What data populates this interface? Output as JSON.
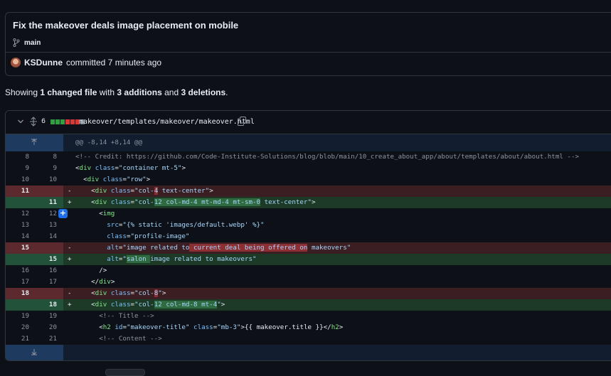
{
  "commit": {
    "title": "Fix the makeover deals image placement on mobile",
    "branch": "main",
    "author": "KSDunne",
    "committed_text": "committed 7 minutes ago"
  },
  "summary": {
    "prefix": "Showing ",
    "files": "1 changed file",
    "mid1": " with ",
    "additions": "3 additions",
    "mid2": " and ",
    "deletions": "3 deletions",
    "suffix": "."
  },
  "file": {
    "change_count": "6",
    "path": "makeover/templates/makeover/makeover.html",
    "diffstat": [
      "add",
      "add",
      "add",
      "del",
      "del",
      "del",
      "neutral"
    ],
    "colors": {
      "add": "#2ea043",
      "del": "#da3633",
      "neutral": "#6e7681"
    }
  },
  "diff": {
    "hunk_header": "@@ -8,14 +8,14 @@",
    "lines": [
      {
        "type": "ctx",
        "old": "8",
        "new": "8",
        "code": "<!-- Credit: https://github.com/Code-Institute-Solutions/blog/blob/main/10_create_about_app/about/templates/about/about.html -->"
      },
      {
        "type": "ctx",
        "old": "9",
        "new": "9",
        "code": "<div class=\"container mt-5\">"
      },
      {
        "type": "ctx",
        "old": "10",
        "new": "10",
        "code": "  <div class=\"row\">"
      },
      {
        "type": "del",
        "old": "11",
        "new": "",
        "code": "    <div class=\"col-4 text-center\">"
      },
      {
        "type": "add",
        "old": "",
        "new": "11",
        "code": "    <div class=\"col-12 col-md-4 mt-md-4 mt-sm-0 text-center\">"
      },
      {
        "type": "ctx",
        "old": "12",
        "new": "12",
        "code": "      <img"
      },
      {
        "type": "ctx",
        "old": "13",
        "new": "13",
        "code": "        src=\"{% static 'images/default.webp' %}\""
      },
      {
        "type": "ctx",
        "old": "14",
        "new": "14",
        "code": "        class=\"profile-image\""
      },
      {
        "type": "del",
        "old": "15",
        "new": "",
        "code": "        alt=\"image related to current deal being offered on makeovers\""
      },
      {
        "type": "add",
        "old": "",
        "new": "15",
        "code": "        alt=\"salon image related to makeovers\""
      },
      {
        "type": "ctx",
        "old": "16",
        "new": "16",
        "code": "      />"
      },
      {
        "type": "ctx",
        "old": "17",
        "new": "17",
        "code": "    </div>"
      },
      {
        "type": "del",
        "old": "18",
        "new": "",
        "code": "    <div class=\"col-8\">"
      },
      {
        "type": "add",
        "old": "",
        "new": "18",
        "code": "    <div class=\"col-12 col-md-8 mt-4\">"
      },
      {
        "type": "ctx",
        "old": "19",
        "new": "19",
        "code": "      <!-- Title -->"
      },
      {
        "type": "ctx",
        "old": "20",
        "new": "20",
        "code": "      <h2 id=\"makeover-title\" class=\"mb-3\">{{ makeover.title }}</h2>"
      },
      {
        "type": "ctx",
        "old": "21",
        "new": "21",
        "code": "      <!-- Content -->"
      }
    ]
  }
}
